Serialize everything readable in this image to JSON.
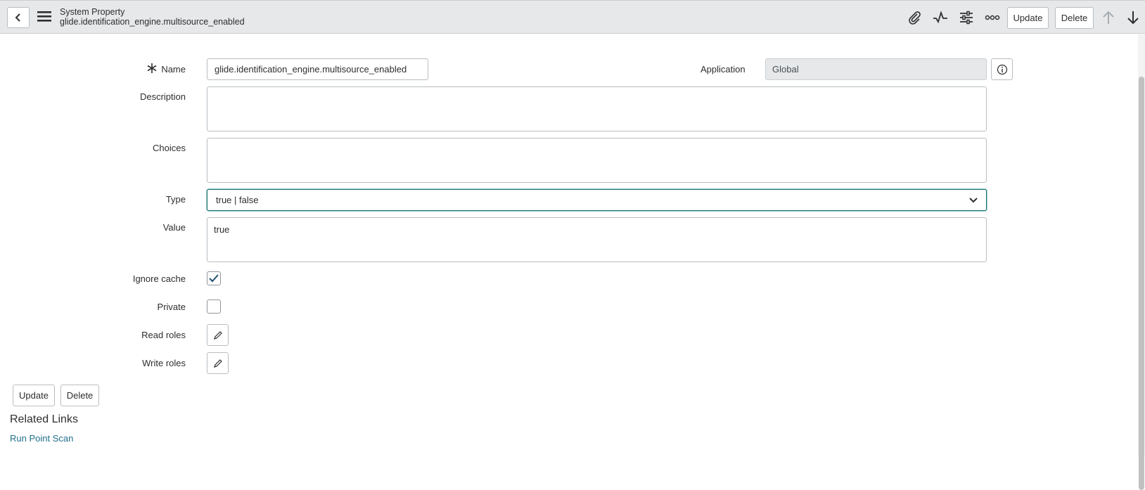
{
  "header": {
    "title": "System Property",
    "subtitle": "glide.identification_engine.multisource_enabled",
    "update_label": "Update",
    "delete_label": "Delete"
  },
  "form": {
    "name_label": "Name",
    "name_value": "glide.identification_engine.multisource_enabled",
    "application_label": "Application",
    "application_value": "Global",
    "description_label": "Description",
    "description_value": "",
    "choices_label": "Choices",
    "choices_value": "",
    "type_label": "Type",
    "type_value": "true | false",
    "value_label": "Value",
    "value_value": "true",
    "ignore_cache_label": "Ignore cache",
    "ignore_cache_checked": true,
    "private_label": "Private",
    "private_checked": false,
    "read_roles_label": "Read roles",
    "write_roles_label": "Write roles"
  },
  "footer": {
    "update_label": "Update",
    "delete_label": "Delete",
    "related_links_title": "Related Links",
    "run_point_scan_label": "Run Point Scan"
  },
  "colors": {
    "header_bg": "#e6e8ea",
    "focus_border": "#1f6f6a",
    "link": "#1f6f8b"
  },
  "icons": [
    "chevron-left-icon",
    "hamburger-menu-icon",
    "paperclip-icon",
    "activity-icon",
    "sliders-icon",
    "more-icon",
    "arrow-up-icon",
    "arrow-down-icon",
    "info-icon",
    "asterisk-icon",
    "checkmark-icon",
    "pencil-icon",
    "chevron-down-icon"
  ]
}
